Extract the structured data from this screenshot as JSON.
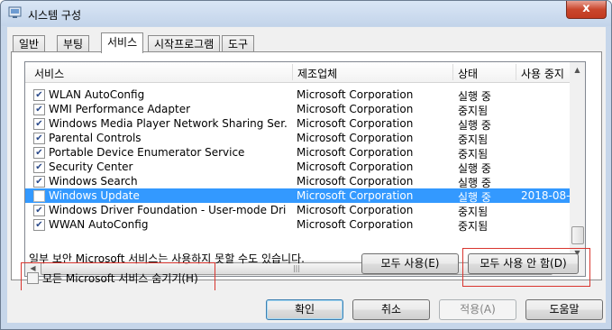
{
  "window": {
    "title": "시스템 구성",
    "close_label": "x"
  },
  "tabs": [
    "일반",
    "부팅",
    "서비스",
    "시작프로그램",
    "도구"
  ],
  "active_tab": "서비스",
  "columns": {
    "service": "서비스",
    "manufacturer": "제조업체",
    "status": "상태",
    "date": "사용 중지"
  },
  "rows": [
    {
      "checked": true,
      "service": "WLAN AutoConfig",
      "manufacturer": "Microsoft Corporation",
      "status": "실행 중",
      "date": ""
    },
    {
      "checked": true,
      "service": "WMI Performance Adapter",
      "manufacturer": "Microsoft Corporation",
      "status": "중지됨",
      "date": ""
    },
    {
      "checked": true,
      "service": "Windows Media Player Network Sharing Ser...",
      "manufacturer": "Microsoft Corporation",
      "status": "실행 중",
      "date": ""
    },
    {
      "checked": true,
      "service": "Parental Controls",
      "manufacturer": "Microsoft Corporation",
      "status": "중지됨",
      "date": ""
    },
    {
      "checked": true,
      "service": "Portable Device Enumerator Service",
      "manufacturer": "Microsoft Corporation",
      "status": "중지됨",
      "date": ""
    },
    {
      "checked": true,
      "service": "Security Center",
      "manufacturer": "Microsoft Corporation",
      "status": "실행 중",
      "date": ""
    },
    {
      "checked": true,
      "service": "Windows Search",
      "manufacturer": "Microsoft Corporation",
      "status": "실행 중",
      "date": ""
    },
    {
      "checked": false,
      "service": "Windows Update",
      "manufacturer": "Microsoft Corporation",
      "status": "실행 중",
      "date": "2018-08-...",
      "selected": true
    },
    {
      "checked": true,
      "service": "Windows Driver Foundation - User-mode Dri...",
      "manufacturer": "Microsoft Corporation",
      "status": "중지됨",
      "date": ""
    },
    {
      "checked": true,
      "service": "WWAN AutoConfig",
      "manufacturer": "Microsoft Corporation",
      "status": "중지됨",
      "date": ""
    }
  ],
  "note": "일부 보안 Microsoft 서비스는 사용하지 못할 수도 있습니다.",
  "enable_all_label": "모두 사용(E)",
  "disable_all_label": "모두 사용 안 함(D)",
  "hide_ms_label": "모든 Microsoft 서비스 숨기기(H)",
  "hide_ms_checked": false,
  "buttons": {
    "ok": "확인",
    "cancel": "취소",
    "apply": "적용(A)",
    "help": "도움말"
  },
  "colors": {
    "selection": "#3399ff",
    "highlight_box": "#d9352f",
    "close_button": "#c9462c"
  },
  "icons": {
    "title": "system-config-icon",
    "close": "close-icon",
    "check": "checkmark-icon"
  }
}
